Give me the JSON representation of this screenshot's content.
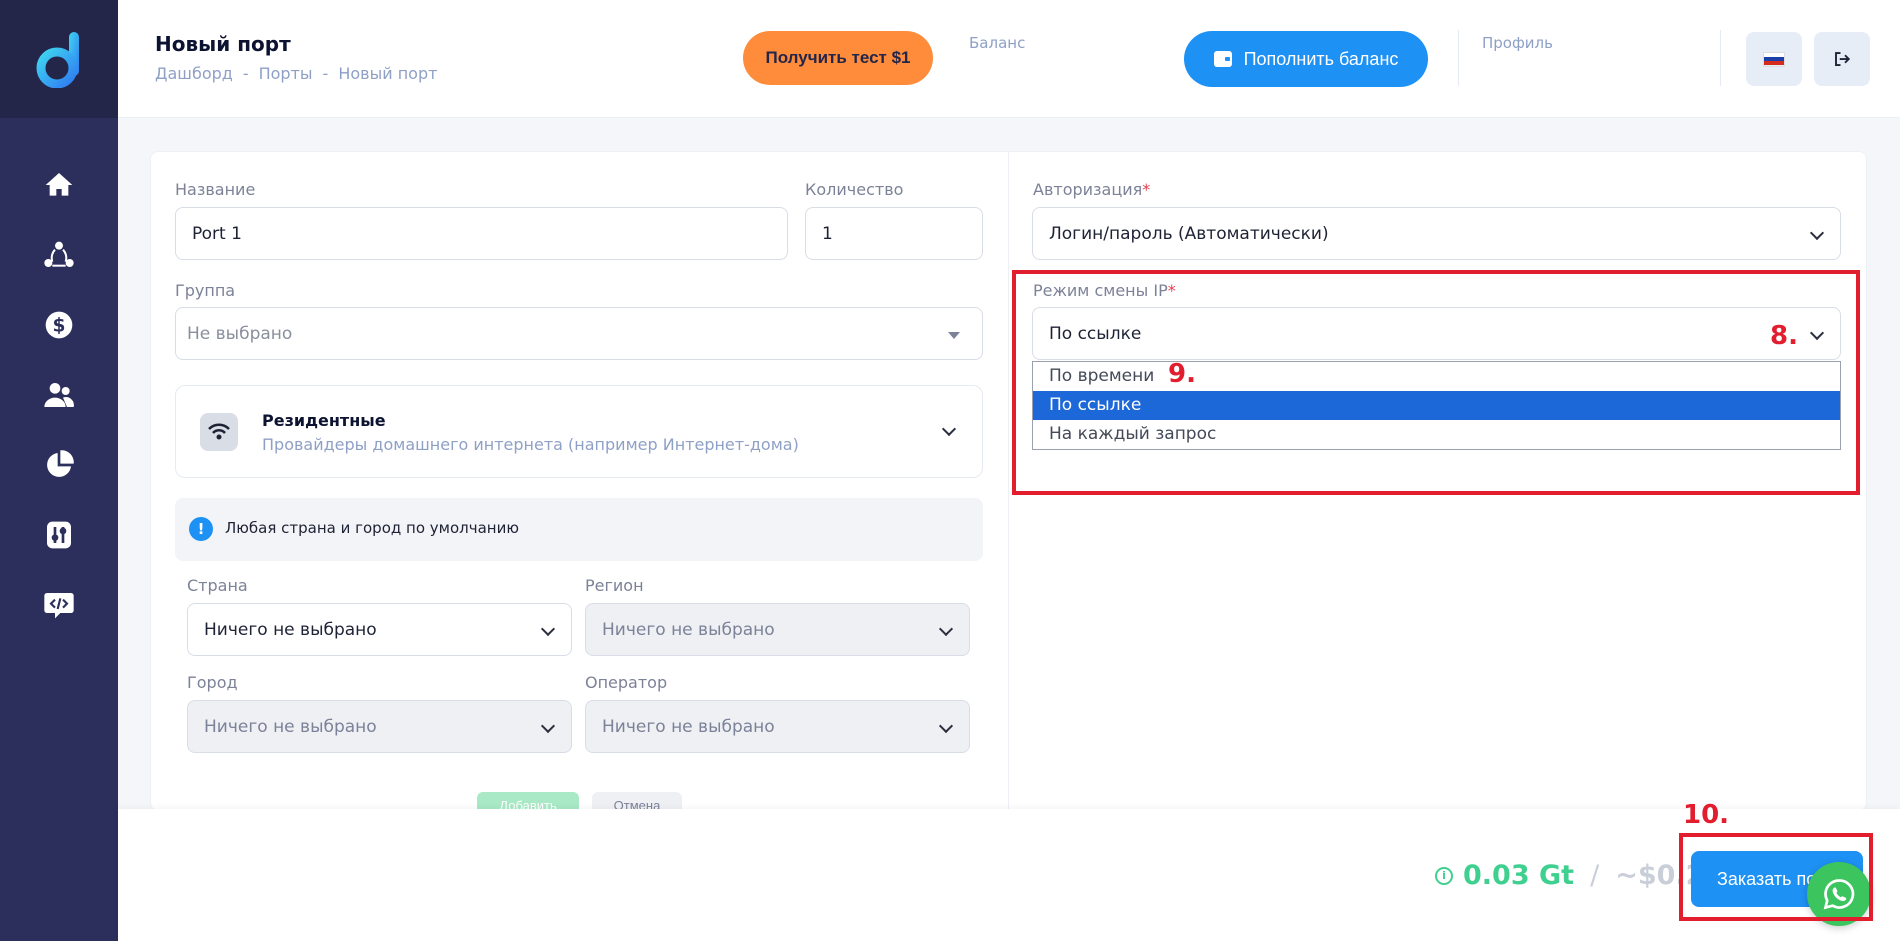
{
  "header": {
    "title": "Новый порт",
    "breadcrumb": [
      "Дашборд",
      "-",
      "Порты",
      "-",
      "Новый порт"
    ],
    "test_button": "Получить тест $1",
    "balance_label": "Баланс",
    "topup_button": "Пополнить баланс",
    "profile_label": "Профиль"
  },
  "sidebar": {
    "items": [
      {
        "icon": "home-icon"
      },
      {
        "icon": "network-icon"
      },
      {
        "icon": "dollar-icon"
      },
      {
        "icon": "users-icon"
      },
      {
        "icon": "pie-chart-icon"
      },
      {
        "icon": "sliders-icon"
      },
      {
        "icon": "code-icon"
      }
    ]
  },
  "form": {
    "name_label": "Название",
    "name_value": "Port 1",
    "qty_label": "Количество",
    "qty_value": "1",
    "group_label": "Группа",
    "group_placeholder": "Не выбрано",
    "residential_title": "Резидентные",
    "residential_sub": "Провайдеры домашнего интернета (например Интернет-дома)",
    "info_text": "Любая страна и город по умолчанию",
    "country_label": "Страна",
    "country_value": "Ничего не выбрано",
    "region_label": "Регион",
    "region_value": "Ничего не выбрано",
    "city_label": "Город",
    "city_value": "Ничего не выбрано",
    "operator_label": "Оператор",
    "operator_value": "Ничего не выбрано",
    "add_button": "Добавить",
    "cancel_button": "Отмена",
    "auth_label": "Авторизация",
    "auth_value": "Логин/пароль (Автоматически)",
    "ipmode_label": "Режим смены IP",
    "ipmode_value": "По ссылке",
    "ipmode_options": [
      "По времени",
      "По ссылке",
      "На каждый запрос"
    ],
    "required_mark": "*"
  },
  "annotations": {
    "n8": "8.",
    "n9": "9.",
    "n10": "10."
  },
  "footer": {
    "gt_price": "0.03 Gt",
    "slash": "/",
    "usd_price": "~$0.2",
    "order_button": "Заказать порт"
  },
  "colors": {
    "sidebar": "#2c2f5b",
    "accent_blue": "#1e91f5",
    "accent_orange": "#ff8c3a",
    "accent_green": "#3fd08f",
    "annotation_red": "#e11d2e"
  }
}
